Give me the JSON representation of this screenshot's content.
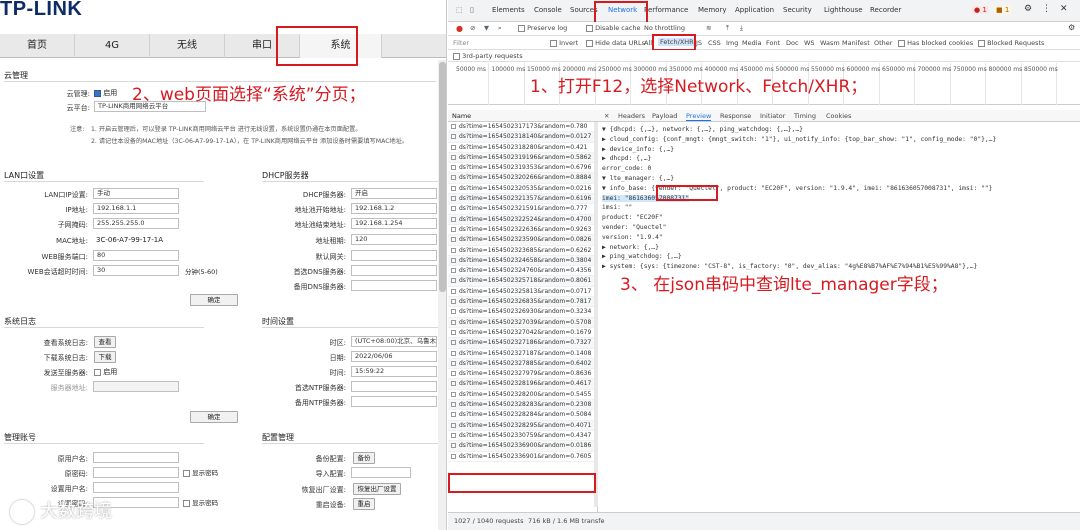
{
  "tplink": {
    "logo": "TP-LINK",
    "nav": [
      "首页",
      "4G",
      "无线",
      "串口",
      "系统"
    ],
    "cloud": {
      "title": "云管理",
      "cloud_mgmt_label": "云管理:",
      "enable_label": "启用",
      "cloud_platform_label": "云平台:",
      "cloud_platform_value": "TP-LINK商用网络云平台",
      "note_label": "注意:",
      "note1": "1. 开启云管理后，可以登录 TP-LINK商用网络云平台 进行无线设置，系统设置仍通在本页面配置。",
      "note2": "2. 请记住本设备的MAC地址（3C-06-A7-99-17-1A），在 TP-LINK商用网络云平台 添加设备时需要填写MAC地址。"
    },
    "lan": {
      "title": "LAN口设置",
      "fields": [
        {
          "label": "LAN口IP设置:",
          "value": "手动"
        },
        {
          "label": "IP地址:",
          "value": "192.168.1.1"
        },
        {
          "label": "子网掩码:",
          "value": "255.255.255.0"
        },
        {
          "label": "MAC地址:",
          "value": "3C-06-A7-99-17-1A"
        },
        {
          "label": "WEB服务端口:",
          "value": "80"
        },
        {
          "label": "WEB会话超时时间:",
          "value": "30"
        }
      ],
      "timeout_unit": "分钟(5-60)",
      "confirm": "确定"
    },
    "dhcp": {
      "title": "DHCP服务器",
      "fields": [
        {
          "label": "DHCP服务器:",
          "value": "开启"
        },
        {
          "label": "地址池开始地址:",
          "value": "192.168.1.2"
        },
        {
          "label": "地址池结束地址:",
          "value": "192.168.1.254"
        },
        {
          "label": "地址租期:",
          "value": "120"
        },
        {
          "label": "默认网关:",
          "value": ""
        },
        {
          "label": "首选DNS服务器:",
          "value": ""
        },
        {
          "label": "备用DNS服务器:",
          "value": ""
        }
      ]
    },
    "syslog": {
      "title": "系统日志",
      "view_label": "查看系统日志:",
      "view_btn": "查看",
      "download_label": "下载系统日志:",
      "download_btn": "下载",
      "send_label": "发送至服务器:",
      "enable_label": "启用",
      "server_label": "服务器地址:",
      "confirm": "确定"
    },
    "time": {
      "title": "时间设置",
      "zone_label": "时区:",
      "zone_value": "(UTC+08:00)北京、乌鲁木齐",
      "date_label": "日期:",
      "date_value": "2022/06/06",
      "time_label": "时间:",
      "time_value": "15:59:22",
      "ntp1_label": "首选NTP服务器:",
      "ntp2_label": "备用NTP服务器:"
    },
    "account": {
      "title": "管理账号",
      "orig_user": "原用户名:",
      "orig_pass": "原密码:",
      "show_pass": "显示密码",
      "new_user": "设置用户名:",
      "new_pass": "设置密码:"
    },
    "config": {
      "title": "配置管理",
      "backup_label": "备份配置:",
      "backup_btn": "备份",
      "import_label": "导入配置:",
      "factory_label": "恢复出厂设置:",
      "factory_btn": "恢复出厂设置",
      "reboot_label": "重启设备:",
      "reboot_btn": "重启"
    }
  },
  "annotations": {
    "step1": "1、打开F12，选择Network、Fetch/XHR；",
    "step2": "2、web页面选择“系统”分页；",
    "step3": "3、 在json串码中查询lte_manager字段；"
  },
  "devtools": {
    "tabs": [
      "Elements",
      "Console",
      "Sources",
      "Network",
      "Performance",
      "Memory",
      "Application",
      "Security",
      "Lighthouse",
      "Recorder"
    ],
    "badges": {
      "errors": "1",
      "warnings": "1"
    },
    "toolbar": {
      "preserve_log": "Preserve log",
      "disable_cache": "Disable cache",
      "throttle": "No throttling"
    },
    "filter": {
      "placeholder": "Filter",
      "invert": "Invert",
      "hide_data": "Hide data URLs",
      "types": [
        "All",
        "Fetch/XHR",
        "JS",
        "CSS",
        "Img",
        "Media",
        "Font",
        "Doc",
        "WS",
        "Wasm",
        "Manifest",
        "Other"
      ],
      "blocked_cookies": "Has blocked cookies",
      "blocked_requests": "Blocked Requests",
      "third_party": "3rd-party requests"
    },
    "timeline_ticks": [
      "50000 ms",
      "100000 ms",
      "150000 ms",
      "200000 ms",
      "250000 ms",
      "300000 ms",
      "350000 ms",
      "400000 ms",
      "450000 ms",
      "500000 ms",
      "550000 ms",
      "600000 ms",
      "650000 ms",
      "700000 ms",
      "750000 ms",
      "800000 ms",
      "850000 ms"
    ],
    "list_header": "Name",
    "requests": [
      "ds?time=1654502317173&random=0.780",
      "ds?time=1654502318140&random=0.0127",
      "ds?time=1654502318280&random=0.421",
      "ds?time=1654502319196&random=0.5862",
      "ds?time=1654502319353&random=0.6796",
      "ds?time=1654502320266&random=0.8884",
      "ds?time=1654502320535&random=0.0216",
      "ds?time=1654502321357&random=0.6196",
      "ds?time=1654502321591&random=0.777",
      "ds?time=1654502322524&random=0.4700",
      "ds?time=1654502322636&random=0.9263",
      "ds?time=1654502323590&random=0.0826",
      "ds?time=1654502323685&random=0.6262",
      "ds?time=1654502324658&random=0.3804",
      "ds?time=1654502324760&random=0.4356",
      "ds?time=1654502325718&random=0.8061",
      "ds?time=1654502325813&random=0.0717",
      "ds?time=1654502326835&random=0.7817",
      "ds?time=1654502326930&random=0.3234",
      "ds?time=1654502327039&random=0.5708",
      "ds?time=1654502327042&random=0.1679",
      "ds?time=1654502327186&random=0.7327",
      "ds?time=1654502327187&random=0.1408",
      "ds?time=1654502327885&random=0.6402",
      "ds?time=1654502327979&random=0.8636",
      "ds?time=1654502328196&random=0.4617",
      "ds?time=1654502328200&random=0.5455",
      "ds?time=1654502328283&random=0.2308",
      "ds?time=1654502328284&random=0.5084",
      "ds?time=1654502328295&random=0.4071",
      "ds?time=1654502330759&random=0.4347",
      "ds?time=1654502336900&random=0.0186",
      "ds?time=1654502336901&random=0.7605"
    ],
    "detail_tabs": [
      "Headers",
      "Payload",
      "Preview",
      "Response",
      "Initiator",
      "Timing",
      "Cookies"
    ],
    "json_lines": [
      "▼ {dhcpd: {,…}, network: {,…}, ping_watchdog: {,…},…}",
      "  ▶ cloud_config: {conf_mngt: {mngt_switch: \"1\"}, ui_notify_info: {top_bar_show: \"1\", config_mode: \"0\"},…}",
      "  ▶ device_info: {,…}",
      "  ▶ dhcpd: {,…}",
      "    error_code: 0",
      "  ▼ lte_manager: {,…}",
      "    ▼ info_base: {vender: \"Quectel\", product: \"EC20F\", version: \"1.9.4\", imei: \"861636057008731\", imsi: \"\"}",
      "        imei: \"861636057008731\"",
      "        imsi: \"\"",
      "        product: \"EC20F\"",
      "        vender: \"Quectel\"",
      "        version: \"1.9.4\"",
      "  ▶ network: {,…}",
      "  ▶ ping_watchdog: {,…}",
      "  ▶ system: {sys: {timezone: \"CST-8\", is_factory: \"0\", dev_alias: \"4g%E8%B7%AF%E7%94%B1%E5%99%A8\"},…}"
    ],
    "status": {
      "requests": "1027 / 1040 requests",
      "transfer": "716 kB / 1.6 MB transfe"
    }
  },
  "watermark": "大数跨境"
}
